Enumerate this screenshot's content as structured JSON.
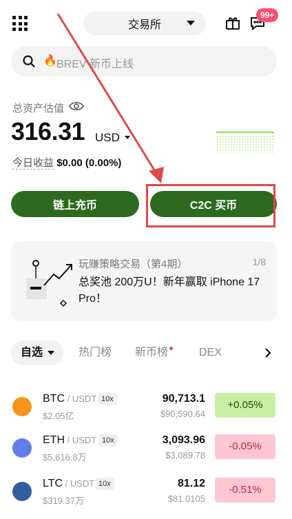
{
  "topbar": {
    "exchange_label": "交易所",
    "badge": "99+"
  },
  "search": {
    "placeholder": "BREV 新币上线"
  },
  "asset": {
    "label": "总资产估值",
    "value": "316.31",
    "unit": "USD",
    "pnl_label": "今日收益",
    "pnl_value": "$0.00 (0.00%)"
  },
  "actions": {
    "deposit": "链上充币",
    "c2c": "C2C 买币"
  },
  "promo": {
    "title": "玩赚策略交易（第4期）",
    "counter": "1/8",
    "desc": "总奖池 200万U！新年赢取 iPhone 17 Pro！"
  },
  "tabs": {
    "favorites": "自选",
    "hot": "热门榜",
    "new": "新币榜",
    "dex": "DEX"
  },
  "market": [
    {
      "symbol": "BTC",
      "quote": " / USDT",
      "leverage": "10x",
      "volume": "$2.05亿",
      "price": "90,713.1",
      "fiat": "$90,590.64",
      "change": "+0.05%",
      "direction": "up",
      "color": "#f7931a"
    },
    {
      "symbol": "ETH",
      "quote": " / USDT",
      "leverage": "10x",
      "volume": "$5,616.8万",
      "price": "3,093.96",
      "fiat": "$3,089.78",
      "change": "-0.05%",
      "direction": "down",
      "color": "#627eea"
    },
    {
      "symbol": "LTC",
      "quote": " / USDT",
      "leverage": "10x",
      "volume": "$319.37万",
      "price": "81.12",
      "fiat": "$81.0105",
      "change": "-0.51%",
      "direction": "down",
      "color": "#345d9d"
    }
  ],
  "colors": {
    "primary_green": "#2d6a1f",
    "up_bg": "#c7f0a4",
    "down_bg": "#ffc6d3",
    "annotation_red": "#e04848"
  }
}
